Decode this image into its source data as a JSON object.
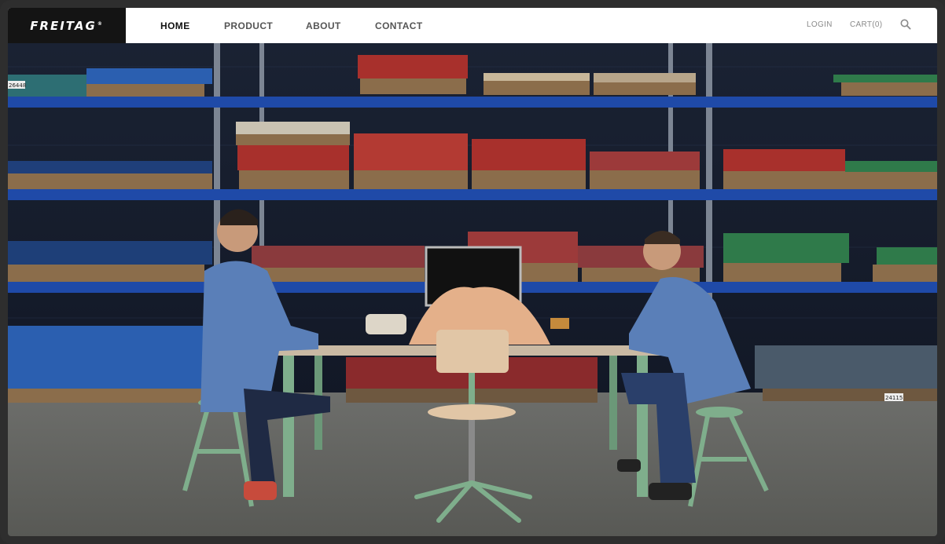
{
  "brand": {
    "name": "FREITAG",
    "mark": "®"
  },
  "nav": {
    "items": [
      {
        "label": "HOME",
        "active": true
      },
      {
        "label": "PRODUCT",
        "active": false
      },
      {
        "label": "ABOUT",
        "active": false
      },
      {
        "label": "CONTACT",
        "active": false
      }
    ],
    "login_label": "LOGIN",
    "cart_label": "CART(0)",
    "search_icon": "search-icon"
  },
  "hero": {
    "shelf_tags": [
      "26448",
      "24115"
    ]
  },
  "colors": {
    "nav_bg": "#ffffff",
    "logo_bg": "#141414",
    "shelf_blue": "#1f4aa8",
    "tarp_red": "#a8302c",
    "tarp_blue": "#2b5fb0",
    "tarp_green": "#2f7a4a",
    "table_leg_green": "#7fae8c",
    "coat_blue": "#5a7fb8"
  }
}
